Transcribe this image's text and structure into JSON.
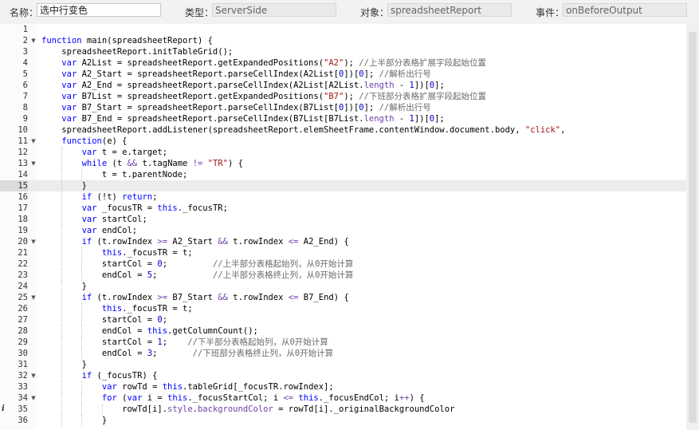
{
  "toolbar": {
    "name_label": "名称：",
    "name_value": "选中行变色",
    "type_label": "类型：",
    "type_value": "ServerSide",
    "object_label": "对象：",
    "object_value": "spreadsheetReport",
    "event_label": "事件：",
    "event_value": "onBeforeOutput"
  },
  "editor": {
    "active_line": 15,
    "info_line": 35,
    "fold_lines": [
      2,
      11,
      13,
      20,
      25,
      32,
      34
    ],
    "lines": [
      "",
      "function main(spreadsheetReport) {",
      "    spreadsheetReport.initTableGrid();",
      "    var A2List = spreadsheetReport.getExpandedPositions(\"A2\"); //上半部分表格扩展字段起始位置",
      "    var A2_Start = spreadsheetReport.parseCellIndex(A2List[0])[0]; //解析出行号",
      "    var A2_End = spreadsheetReport.parseCellIndex(A2List[A2List.length - 1])[0];",
      "    var B7List = spreadsheetReport.getExpandedPositions(\"B7\"); //下班部分表格扩展字段起始位置",
      "    var B7_Start = spreadsheetReport.parseCellIndex(B7List[0])[0]; //解析出行号",
      "    var B7_End = spreadsheetReport.parseCellIndex(B7List[B7List.length - 1])[0];",
      "    spreadsheetReport.addListener(spreadsheetReport.elemSheetFrame.contentWindow.document.body, \"click\",",
      "    function(e) {",
      "        var t = e.target;",
      "        while (t && t.tagName != \"TR\") {",
      "            t = t.parentNode;",
      "        }",
      "        if (!t) return;",
      "        var _focusTR = this._focusTR;",
      "        var startCol;",
      "        var endCol;",
      "        if (t.rowIndex >= A2_Start && t.rowIndex <= A2_End) {",
      "            this._focusTR = t;",
      "            startCol = 0;         //上半部分表格起始列，从0开始计算",
      "            endCol = 5;           //上半部分表格终止列，从0开始计算",
      "        }",
      "        if (t.rowIndex >= B7_Start && t.rowIndex <= B7_End) {",
      "            this._focusTR = t;",
      "            startCol = 0;",
      "            endCol = this.getColumnCount();",
      "            startCol = 1;    //下半部分表格起始列，从0开始计算",
      "            endCol = 3;       //下班部分表格终止列，从0开始计算",
      "        }",
      "        if (_focusTR) {",
      "            var rowTd = this.tableGrid[_focusTR.rowIndex];",
      "            for (var i = this._focusStartCol; i <= this._focusEndCol; i++) {",
      "                rowTd[i].style.backgroundColor = rowTd[i]._originalBackgroundColor",
      "            }"
    ]
  }
}
